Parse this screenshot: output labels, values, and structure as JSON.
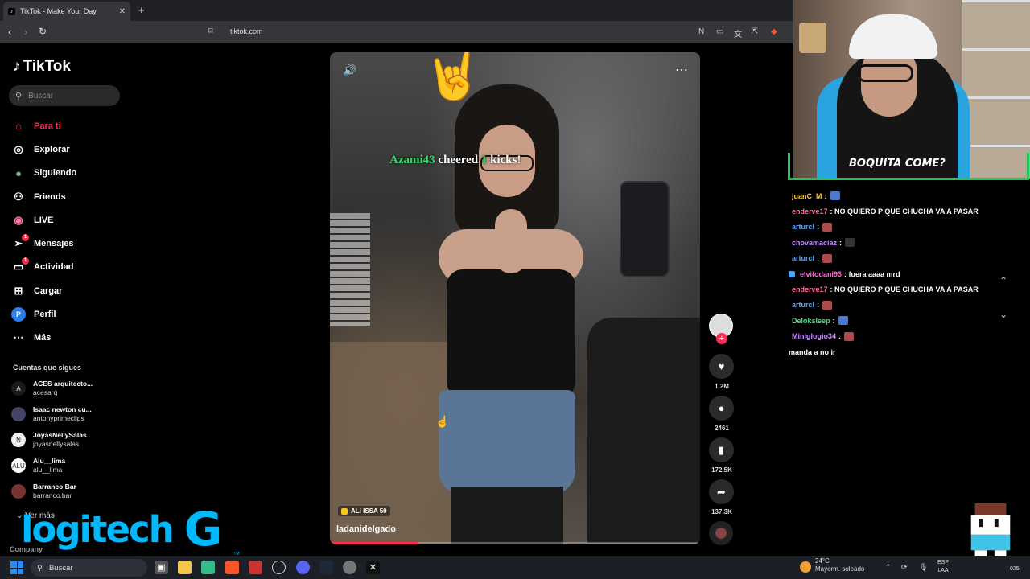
{
  "browser": {
    "tab_title": "TikTok - Make Your Day",
    "tab_close": "✕",
    "new_tab": "+",
    "url": "tiktok.com"
  },
  "sidebar": {
    "logo": "TikTok",
    "search_placeholder": "Buscar",
    "menu": [
      {
        "label": "Para ti",
        "icon": "home-icon",
        "active": true
      },
      {
        "label": "Explorar",
        "icon": "compass-icon"
      },
      {
        "label": "Siguiendo",
        "icon": "following-avatar-icon"
      },
      {
        "label": "Friends",
        "icon": "friends-icon"
      },
      {
        "label": "LIVE",
        "icon": "live-icon"
      },
      {
        "label": "Mensajes",
        "icon": "messages-icon",
        "badge": "1"
      },
      {
        "label": "Actividad",
        "icon": "activity-icon",
        "badge": "1"
      },
      {
        "label": "Cargar",
        "icon": "upload-icon"
      },
      {
        "label": "Perfil",
        "icon": "profile-icon",
        "avatar_letter": "P"
      },
      {
        "label": "Más",
        "icon": "more-icon"
      }
    ],
    "following_header": "Cuentas que sigues",
    "accounts": [
      {
        "name": "ACES arquitecto...",
        "handle": "acesarq",
        "avatar": "A"
      },
      {
        "name": "Isaac newton cu...",
        "handle": "antonyprimeclips",
        "avatar": ""
      },
      {
        "name": "JoyasNellySalas",
        "handle": "joyasnellysalas",
        "avatar": "N"
      },
      {
        "name": "Alu__lima",
        "handle": "alu__lima",
        "avatar": "ALU"
      },
      {
        "name": "Barranco Bar",
        "handle": "barranco.bar",
        "avatar": ""
      }
    ],
    "see_more": "Ver más",
    "company": "Company"
  },
  "overlay_logo": {
    "wordmark": "logitech",
    "g": "G",
    "tm": "TM"
  },
  "video": {
    "cheer_user": "Azami43",
    "cheer_mid": "cheered",
    "cheer_count": "1",
    "cheer_end": "kicks!",
    "tag": "ALI ISSA 50",
    "author": "ladanidelgado",
    "progress": 0.24
  },
  "actions": {
    "likes": "1.2M",
    "comments": "2461",
    "saves": "172.5K",
    "shares": "137.3K"
  },
  "webcam": {
    "shirt_text": "BOQUITA COME?"
  },
  "chat": [
    {
      "user": "juanC_M",
      "color": "#f5c542",
      "msg": ":",
      "emote": "#4a7bd0"
    },
    {
      "user": "enderve17",
      "color": "#ff6b9a",
      "msg": ": NO QUIERO P QUE CHUCHA VA A PASAR"
    },
    {
      "user": "arturcl",
      "color": "#5aa9ff",
      "msg": ":",
      "emote": "#b04a4a"
    },
    {
      "user": "chovamaciaz",
      "color": "#c58bff",
      "msg": ":",
      "emote": "#333333"
    },
    {
      "user": "arturcl",
      "color": "#5aa9ff",
      "msg": ":",
      "emote": "#b04a4a"
    },
    {
      "user": "elvitodani93",
      "color": "#ff6bd6",
      "msg": ": fuera aaaa mrd",
      "badge": true
    },
    {
      "user": "enderve17",
      "color": "#ff6b9a",
      "msg": ": NO QUIERO P QUE CHUCHA VA A PASAR"
    },
    {
      "user": "arturcl",
      "color": "#5aa9ff",
      "msg": ":",
      "emote": "#b04a4a"
    },
    {
      "user": "Deloksleep",
      "color": "#4ade80",
      "msg": ":",
      "emote": "#4a7bd0"
    },
    {
      "user": "Miniglogio34",
      "color": "#c58bff",
      "msg": ":",
      "emote": "#b04a4a"
    },
    {
      "user": "",
      "color": "#ffffff",
      "msg": "manda a no ir"
    }
  ],
  "taskbar": {
    "search": "Buscar",
    "temp": "24°C",
    "weather": "Mayorm. soleado",
    "lang1": "ESP",
    "lang2": "LAA",
    "clock_frag": "025"
  }
}
